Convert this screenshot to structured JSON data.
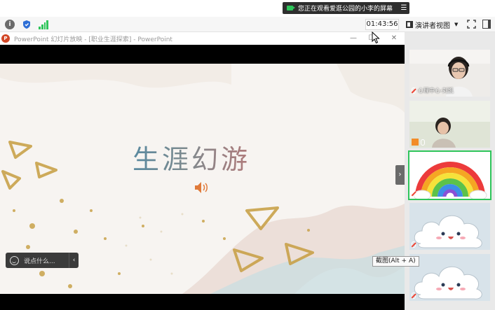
{
  "banner": {
    "share_notice": "您正在观看爱逛公园的小李的屏幕",
    "menu_icon": "menu-lines-icon"
  },
  "toolbar": {
    "info_icon": "info-icon",
    "shield_icon": "shield-icon",
    "signal_icon": "signal-bars-icon",
    "timer": "01:43:56",
    "presenter_view_label": "演讲者视图",
    "fullscreen_icon": "fullscreen-icon",
    "panel_icon": "panel-toggle-icon"
  },
  "ppt_window": {
    "logo_letter": "P",
    "title": "PowerPoint 幻灯片放映 - [职业生涯探索] - PowerPoint",
    "min_glyph": "—",
    "max_glyph": "☐",
    "close_glyph": "✕"
  },
  "slide": {
    "title": "生涯幻游",
    "audio_icon": "speaker-icon"
  },
  "chat": {
    "placeholder": "说点什么...",
    "collapse_glyph": "‹"
  },
  "video_panel": {
    "collapse_glyph": "›",
    "tiles": [
      {
        "label": "心理中心-刘凯",
        "mic": "muted"
      },
      {
        "label": "",
        "mic": "on"
      },
      {
        "label": "",
        "mic": "off"
      },
      {
        "label": "",
        "mic": "off"
      },
      {
        "label": "",
        "mic": "off"
      }
    ]
  },
  "tooltip": "截图(Alt + A)",
  "colors": {
    "accent_green": "#2ec55a",
    "ppt_red": "#d24726",
    "gold": "#c9a24a"
  }
}
